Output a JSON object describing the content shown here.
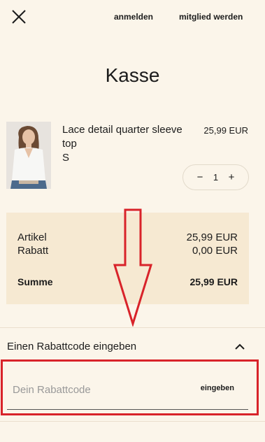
{
  "header": {
    "login_label": "anmelden",
    "signup_label": "mitglied werden"
  },
  "page": {
    "title": "Kasse"
  },
  "cart_item": {
    "name": "Lace detail quarter sleeve top",
    "size": "S",
    "price": "25,99 EUR",
    "quantity": "1",
    "minus_symbol": "−",
    "plus_symbol": "+"
  },
  "summary": {
    "items_label": "Artikel",
    "items_value": "25,99 EUR",
    "discount_label": "Rabatt",
    "discount_value": "0,00 EUR",
    "total_label": "Summe",
    "total_value": "25,99 EUR"
  },
  "coupon": {
    "toggle_label": "Einen Rabattcode eingeben",
    "input_placeholder": "Dein Rabattcode",
    "input_value": "",
    "submit_label": "eingeben"
  },
  "icons": {
    "close": "close-icon",
    "collapse": "chevron-up-icon"
  },
  "colors": {
    "background": "#fbf5ea",
    "summary_background": "#f6e9d2",
    "annotation_red": "#d8232a"
  }
}
